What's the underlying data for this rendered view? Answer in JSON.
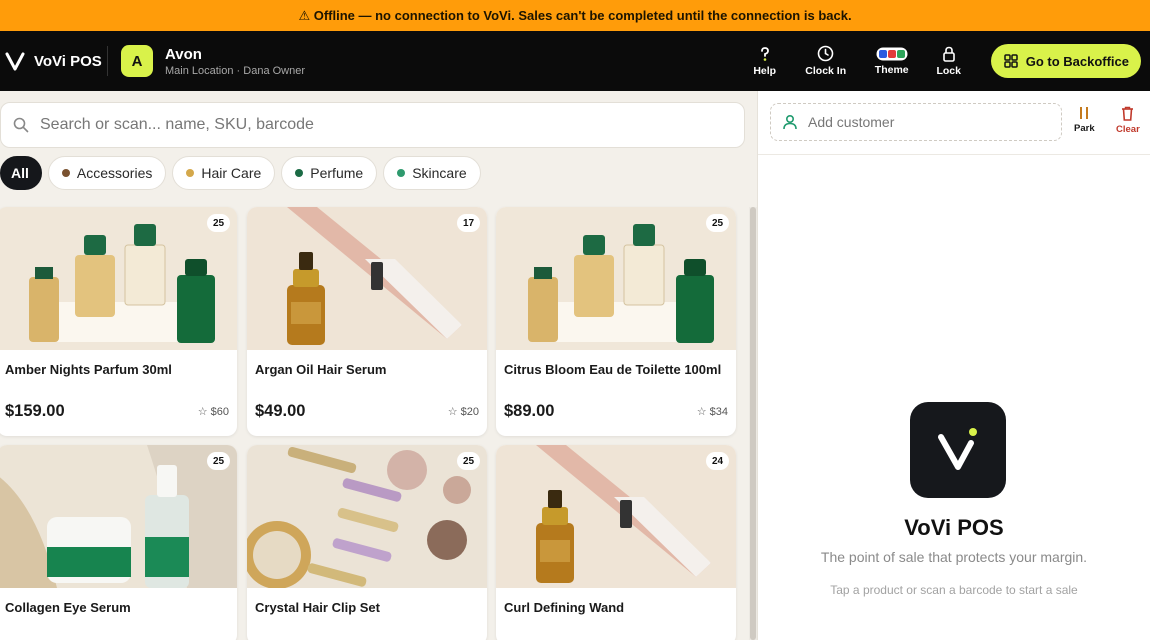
{
  "banner": {
    "icon": "warning-icon",
    "text": "⚠ Offline — no connection to VoVi. Sales can't be completed until the connection is back."
  },
  "topbar": {
    "brand": "VoVi POS",
    "store": {
      "initial": "A",
      "name": "Avon",
      "subtitle": "Main Location · Dana Owner"
    },
    "actions": [
      {
        "label": "Help",
        "icon": "help-icon"
      },
      {
        "label": "Clock In",
        "icon": "clock-icon"
      },
      {
        "label": "Theme",
        "icon": "theme-icon"
      },
      {
        "label": "Lock",
        "icon": "lock-icon"
      }
    ],
    "backoffice": "Go to Backoffice"
  },
  "search": {
    "placeholder": "Search or scan... name, SKU, barcode"
  },
  "categories": [
    {
      "label": "All",
      "active": true
    },
    {
      "label": "Accessories",
      "color": "#7a5230"
    },
    {
      "label": "Hair Care",
      "color": "#d4a84b"
    },
    {
      "label": "Perfume",
      "color": "#1b6b45"
    },
    {
      "label": "Skincare",
      "color": "#2e9a6e"
    }
  ],
  "products": [
    {
      "name": "Amber Nights Parfum 30ml",
      "price": "$159.00",
      "margin": "$60",
      "stock": "25",
      "image": "perfume-bottles"
    },
    {
      "name": "Argan Oil Hair Serum",
      "price": "$49.00",
      "margin": "$20",
      "stock": "17",
      "image": "straightener-serum"
    },
    {
      "name": "Citrus Bloom Eau de Toilette 100ml",
      "price": "$89.00",
      "margin": "$34",
      "stock": "25",
      "image": "perfume-bottles"
    },
    {
      "name": "Collagen Eye Serum",
      "price": "",
      "margin": "",
      "stock": "25",
      "image": "skincare-jars"
    },
    {
      "name": "Crystal Hair Clip Set",
      "price": "",
      "margin": "",
      "stock": "25",
      "image": "hair-clips"
    },
    {
      "name": "Curl Defining Wand",
      "price": "",
      "margin": "",
      "stock": "24",
      "image": "straightener-serum"
    }
  ],
  "cart": {
    "customer_placeholder": "Add customer",
    "park": "Park",
    "clear": "Clear",
    "empty_title": "VoVi POS",
    "empty_tagline": "The point of sale that protects your margin.",
    "empty_hint": "Tap a product or scan a barcode to start a sale"
  },
  "colors": {
    "banner": "#ff9c0a",
    "accent": "#d9f24a",
    "topbar": "#0b0b0b",
    "clear": "#c0392b",
    "park": "#c47a1e"
  }
}
